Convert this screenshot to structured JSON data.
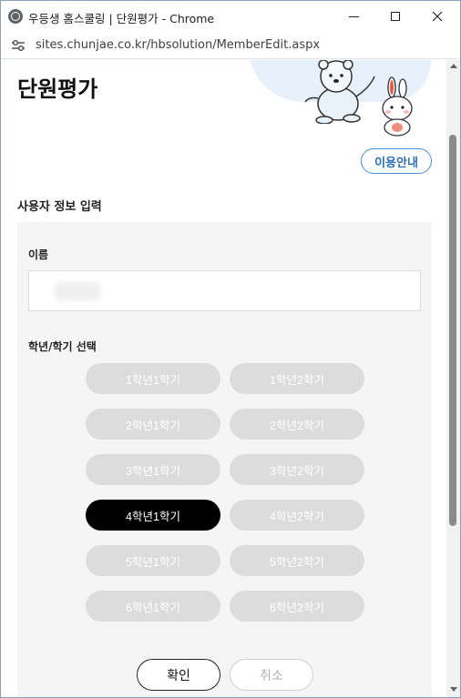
{
  "window": {
    "title": "우등생 홈스쿨링 | 단원평가 - Chrome",
    "url": "sites.chunjae.co.kr/hbsolution/MemberEdit.aspx"
  },
  "header": {
    "title": "단원평가",
    "guide_button": "이용안내"
  },
  "form": {
    "section_title": "사용자 정보 입력",
    "name_label": "이름",
    "name_value": "",
    "grade_label": "학년/학기 선택",
    "grades": [
      {
        "label": "1학년1학기",
        "selected": false
      },
      {
        "label": "1학년2학기",
        "selected": false
      },
      {
        "label": "2학년1학기",
        "selected": false
      },
      {
        "label": "2학년2학기",
        "selected": false
      },
      {
        "label": "3학년1학기",
        "selected": false
      },
      {
        "label": "3학년2학기",
        "selected": false
      },
      {
        "label": "4학년1학기",
        "selected": true
      },
      {
        "label": "4학년2학기",
        "selected": false
      },
      {
        "label": "5학년1학기",
        "selected": false
      },
      {
        "label": "5학년2학기",
        "selected": false
      },
      {
        "label": "6학년1학기",
        "selected": false
      },
      {
        "label": "6학년2학기",
        "selected": false
      }
    ],
    "confirm_label": "확인",
    "cancel_label": "취소"
  },
  "colors": {
    "selected": "#000000",
    "unselected": "#dcdcdc",
    "accent": "#4a90d9"
  }
}
